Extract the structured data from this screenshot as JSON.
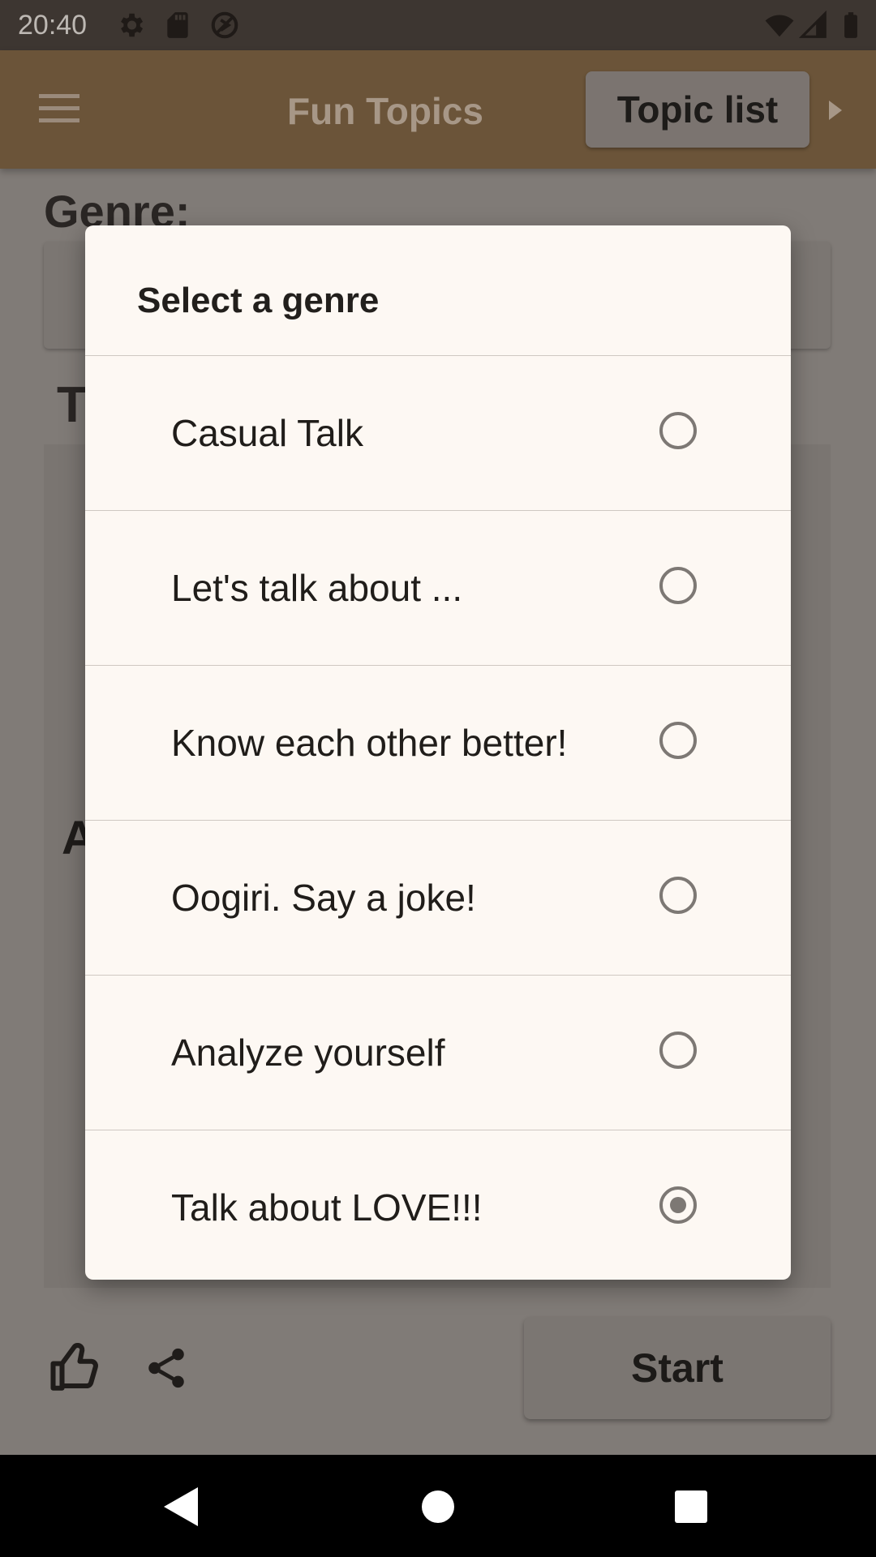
{
  "status_bar": {
    "time": "20:40"
  },
  "app_bar": {
    "title": "Fun Topics",
    "topic_list_label": "Topic list"
  },
  "main": {
    "genre_label": "Genre:",
    "topic_label_partial": "T",
    "topic_text_partial": "A a",
    "start_label": "Start"
  },
  "dialog": {
    "title": "Select a genre",
    "options": [
      {
        "label": "Casual Talk",
        "selected": false
      },
      {
        "label": "Let's talk about ...",
        "selected": false
      },
      {
        "label": "Know each other better!",
        "selected": false
      },
      {
        "label": "Oogiri. Say a joke!",
        "selected": false
      },
      {
        "label": "Analyze yourself",
        "selected": false
      },
      {
        "label": "Talk about LOVE!!!",
        "selected": true
      }
    ]
  }
}
